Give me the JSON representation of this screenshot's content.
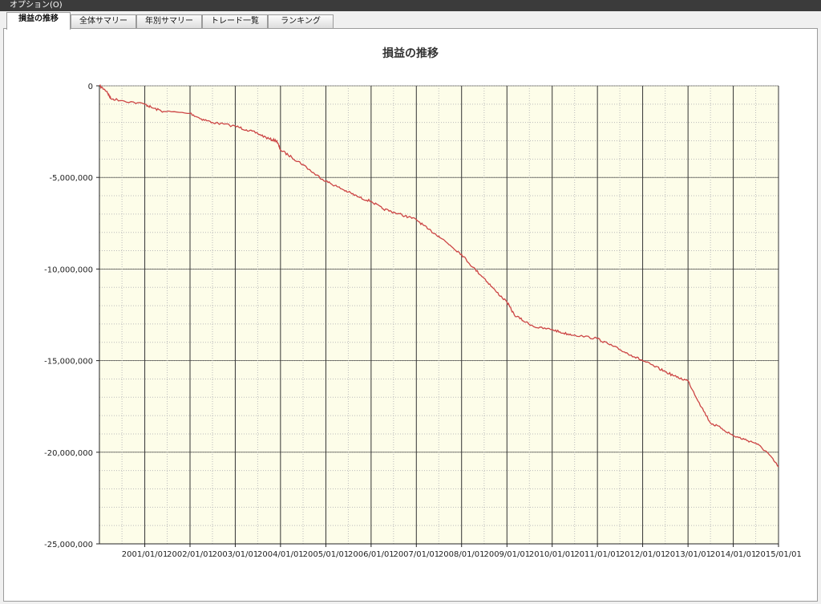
{
  "menubar": {
    "label": "オプション(O)"
  },
  "tabs": [
    {
      "label": "損益の推移",
      "active": true
    },
    {
      "label": "全体サマリー",
      "active": false
    },
    {
      "label": "年別サマリー",
      "active": false
    },
    {
      "label": "トレード一覧",
      "active": false
    },
    {
      "label": "ランキング",
      "active": false
    }
  ],
  "colors": {
    "plot_background": "#fdfde9",
    "series_line": "#cc4444",
    "grid_major": "#333333",
    "grid_minor": "#bbbbbb"
  },
  "chart_data": {
    "type": "line",
    "title": "損益の推移",
    "xlabel": "",
    "ylabel": "",
    "ylim": [
      -25000000,
      0
    ],
    "xlim": [
      "2000-01-01",
      "2015-01-01"
    ],
    "grid": true,
    "y_ticks": [
      0,
      -5000000,
      -10000000,
      -15000000,
      -20000000,
      -25000000
    ],
    "y_tick_labels": [
      "0",
      "-5,000,000",
      "-10,000,000",
      "-15,000,000",
      "-20,000,000",
      "-25,000,000"
    ],
    "x_ticks": [
      "2001-01-01",
      "2002-01-01",
      "2003-01-01",
      "2004-01-01",
      "2005-01-01",
      "2006-01-01",
      "2007-01-01",
      "2008-01-01",
      "2009-01-01",
      "2010-01-01",
      "2011-01-01",
      "2012-01-01",
      "2013-01-01",
      "2014-01-01",
      "2015-01-01"
    ],
    "x_tick_labels": [
      "2001/01/01",
      "2002/01/01",
      "2003/01/01",
      "2004/01/01",
      "2005/01/01",
      "2006/01/01",
      "2007/01/01",
      "2008/01/01",
      "2009/01/01",
      "2010/01/01",
      "2011/01/01",
      "2012/01/01",
      "2013/01/01",
      "2014/01/01",
      "2015/01/01"
    ],
    "series": [
      {
        "x": [
          "2000-01-01",
          "2000-03-01",
          "2000-04-01",
          "2000-07-01",
          "2001-01-01",
          "2001-03-01",
          "2001-06-01",
          "2002-01-01",
          "2002-04-01",
          "2002-07-01",
          "2003-01-01",
          "2003-04-01",
          "2003-07-01",
          "2003-10-01",
          "2003-12-01",
          "2004-01-01",
          "2004-04-01",
          "2004-07-01",
          "2004-10-01",
          "2005-01-01",
          "2005-04-01",
          "2005-07-01",
          "2005-10-01",
          "2006-01-01",
          "2006-04-01",
          "2006-07-01",
          "2006-10-01",
          "2007-01-01",
          "2007-04-01",
          "2007-07-01",
          "2007-10-01",
          "2008-01-01",
          "2008-04-01",
          "2008-07-01",
          "2008-10-01",
          "2009-01-01",
          "2009-03-01",
          "2009-06-01",
          "2009-09-01",
          "2010-01-01",
          "2010-04-01",
          "2010-07-01",
          "2011-01-01",
          "2011-04-01",
          "2011-07-01",
          "2011-10-01",
          "2012-01-01",
          "2012-04-01",
          "2012-07-01",
          "2012-10-01",
          "2013-01-01",
          "2013-04-01",
          "2013-07-01",
          "2013-10-01",
          "2014-01-01",
          "2014-04-01",
          "2014-07-01",
          "2014-10-01",
          "2015-01-01"
        ],
        "values": [
          0,
          -300000,
          -700000,
          -800000,
          -1000000,
          -1200000,
          -1400000,
          -1500000,
          -1800000,
          -2000000,
          -2200000,
          -2400000,
          -2600000,
          -2900000,
          -3000000,
          -3500000,
          -3900000,
          -4300000,
          -4800000,
          -5200000,
          -5500000,
          -5800000,
          -6100000,
          -6300000,
          -6700000,
          -6900000,
          -7100000,
          -7300000,
          -7800000,
          -8200000,
          -8700000,
          -9200000,
          -9900000,
          -10500000,
          -11200000,
          -11800000,
          -12500000,
          -12900000,
          -13200000,
          -13300000,
          -13500000,
          -13600000,
          -13800000,
          -14100000,
          -14400000,
          -14700000,
          -15000000,
          -15300000,
          -15600000,
          -15900000,
          -16100000,
          -17300000,
          -18400000,
          -18700000,
          -19100000,
          -19300000,
          -19500000,
          -20000000,
          -20800000
        ]
      }
    ]
  }
}
